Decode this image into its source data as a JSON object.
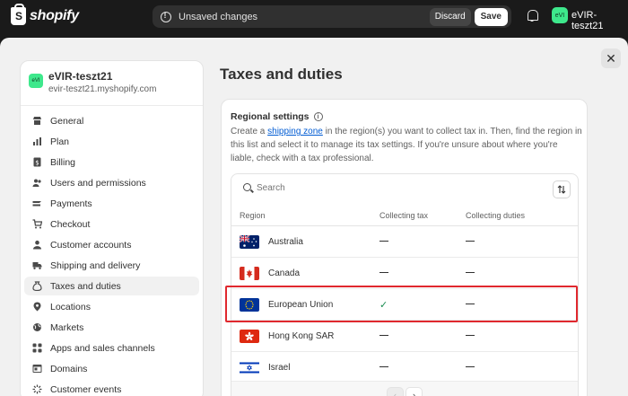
{
  "topbar": {
    "brand": "shopify",
    "unsaved_text": "Unsaved changes",
    "discard_label": "Discard",
    "save_label": "Save",
    "store_initials": "eVI",
    "store_name": "eVIR-teszt21"
  },
  "close_label": "✕",
  "sidebar": {
    "store_initials": "eVI",
    "store_name": "eVIR-teszt21",
    "store_domain": "evir-teszt21.myshopify.com",
    "items": [
      {
        "label": "General",
        "icon": "store-icon"
      },
      {
        "label": "Plan",
        "icon": "plan-icon"
      },
      {
        "label": "Billing",
        "icon": "billing-icon"
      },
      {
        "label": "Users and permissions",
        "icon": "users-icon"
      },
      {
        "label": "Payments",
        "icon": "payments-icon"
      },
      {
        "label": "Checkout",
        "icon": "cart-icon"
      },
      {
        "label": "Customer accounts",
        "icon": "person-icon"
      },
      {
        "label": "Shipping and delivery",
        "icon": "truck-icon"
      },
      {
        "label": "Taxes and duties",
        "icon": "tax-icon",
        "active": true
      },
      {
        "label": "Locations",
        "icon": "location-icon"
      },
      {
        "label": "Markets",
        "icon": "globe-icon"
      },
      {
        "label": "Apps and sales channels",
        "icon": "apps-icon"
      },
      {
        "label": "Domains",
        "icon": "domain-icon"
      },
      {
        "label": "Customer events",
        "icon": "events-icon"
      }
    ]
  },
  "main": {
    "title": "Taxes and duties",
    "card": {
      "title": "Regional settings",
      "desc_before": "Create a ",
      "desc_link": "shipping zone",
      "desc_after": " in the region(s) you want to collect tax in. Then, find the region in this list and select it to manage its tax settings. If you're unsure about where you're liable, check with a tax professional."
    },
    "search_placeholder": "Search",
    "columns": [
      "Region",
      "Collecting tax",
      "Collecting duties"
    ],
    "rows": [
      {
        "region": "Australia",
        "flag": "australia-flag",
        "tax": false,
        "duties": false
      },
      {
        "region": "Canada",
        "flag": "canada-flag",
        "tax": false,
        "duties": false
      },
      {
        "region": "European Union",
        "flag": "eu-flag",
        "tax": true,
        "duties": false
      },
      {
        "region": "Hong Kong SAR",
        "flag": "hong-kong-flag",
        "tax": false,
        "duties": false
      },
      {
        "region": "Israel",
        "flag": "israel-flag",
        "tax": false,
        "duties": false
      }
    ],
    "pagination": {
      "prev": "‹",
      "next": "›"
    }
  },
  "colors": {
    "accent_green": "#3ee88c",
    "link": "#005bd3",
    "highlight": "#e0282e",
    "check": "#1a8c50"
  }
}
